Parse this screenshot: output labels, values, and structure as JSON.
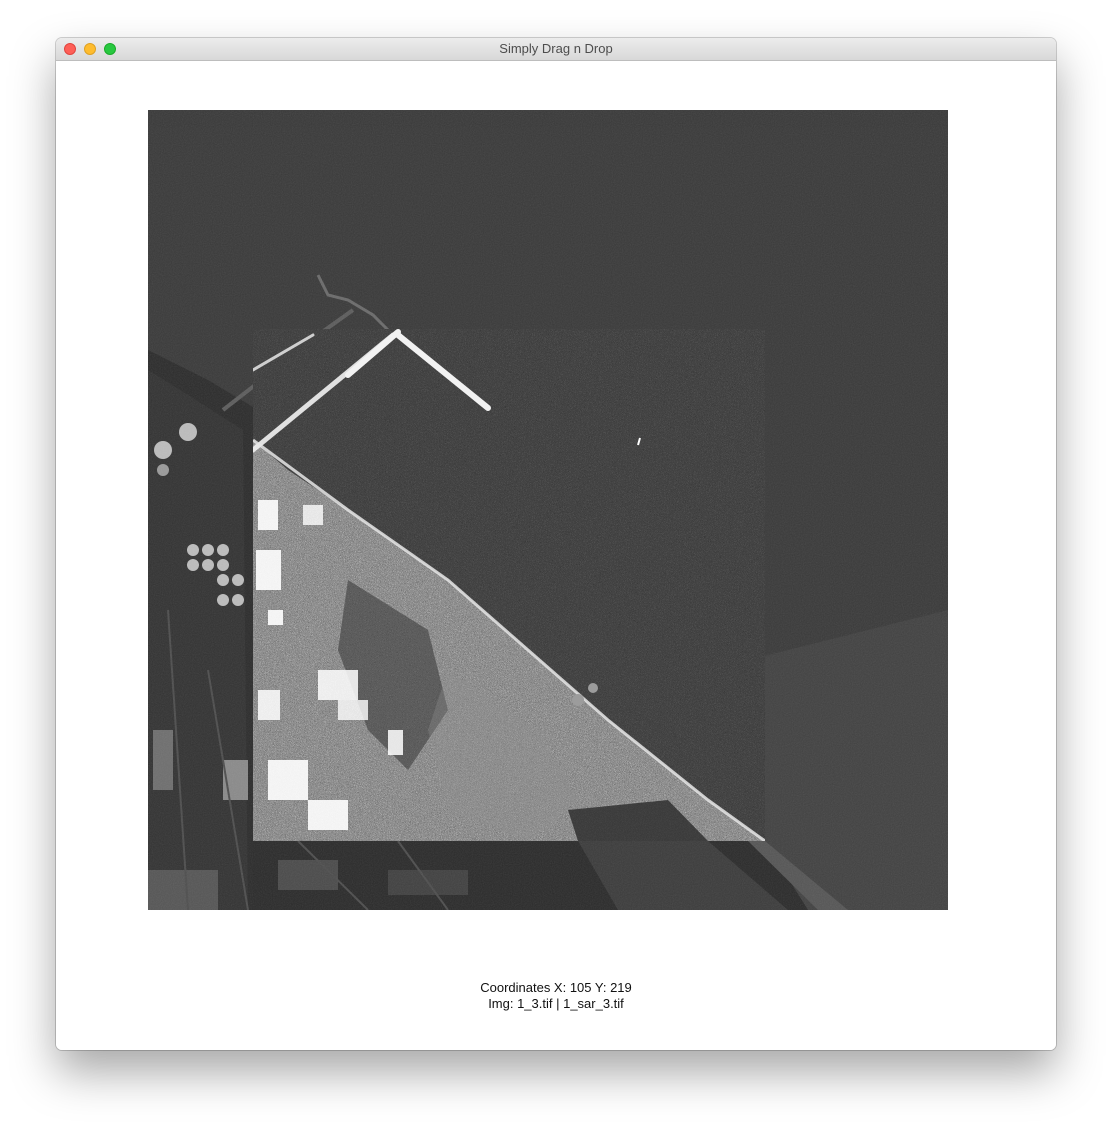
{
  "window": {
    "title": "Simply Drag n Drop"
  },
  "canvas": {
    "base_image_name": "optical-satellite-image",
    "overlay_image_name": "sar-image-overlay"
  },
  "status": {
    "coordinates": "Coordinates X: 105 Y: 219",
    "images": "Img: 1_3.tif | 1_sar_3.tif"
  },
  "colors": {
    "close": "#fe5f57",
    "minimize": "#febc2e",
    "zoom": "#28c840",
    "sea": "#3a3a3a"
  }
}
